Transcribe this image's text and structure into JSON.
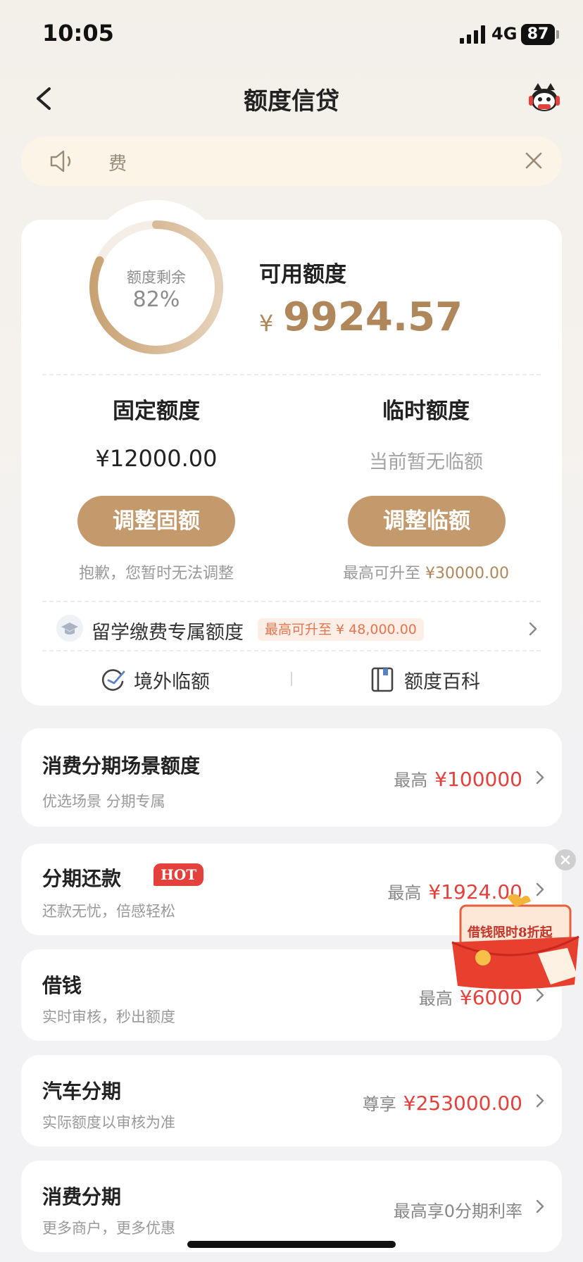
{
  "status_bar": {
    "time": "10:05",
    "network": "4G",
    "battery": "87"
  },
  "nav": {
    "title": "额度信贷"
  },
  "notice": {
    "text": "费"
  },
  "quota": {
    "ring_label": "额度剩余",
    "ring_percent": "82%",
    "ring_fraction": 0.82,
    "available_label": "可用额度",
    "currency": "¥",
    "available_amount": "9924.57",
    "fixed": {
      "title": "固定额度",
      "amount": "¥12000.00",
      "button": "调整固额",
      "note": "抱歉，您暂时无法调整"
    },
    "temporary": {
      "title": "临时额度",
      "status": "当前暂无临额",
      "button": "调整临额",
      "note_prefix": "最高可升至",
      "note_amount": "¥30000.00"
    },
    "study": {
      "label": "留学缴费专属额度",
      "badge": "最高可升至 ¥ 48,000.00"
    },
    "links": {
      "overseas": "境外临额",
      "wiki": "额度百科"
    }
  },
  "products": [
    {
      "title": "消费分期场景额度",
      "subtitle": "优选场景 分期专属",
      "prefix": "最高",
      "value": "¥100000"
    },
    {
      "title": "分期还款",
      "badge": "HOT",
      "subtitle": "还款无忧，倍感轻松",
      "prefix": "最高",
      "value": "¥1924.00"
    },
    {
      "title": "借钱",
      "subtitle": "实时审核，秒出额度",
      "prefix": "最高",
      "value": "¥6000"
    },
    {
      "title": "汽车分期",
      "subtitle": "实际额度以审核为准",
      "prefix": "尊享",
      "value": "¥253000.00"
    },
    {
      "title": "消费分期",
      "subtitle": "更多商户，更多优惠",
      "plain": "最高享0分期利率"
    }
  ],
  "promo": {
    "text": "借钱限时8折起"
  },
  "colors": {
    "gold": "#c49a6c",
    "gold_text": "#b0875a",
    "red": "#e4403c",
    "notice_bg": "#fcf4e6"
  }
}
